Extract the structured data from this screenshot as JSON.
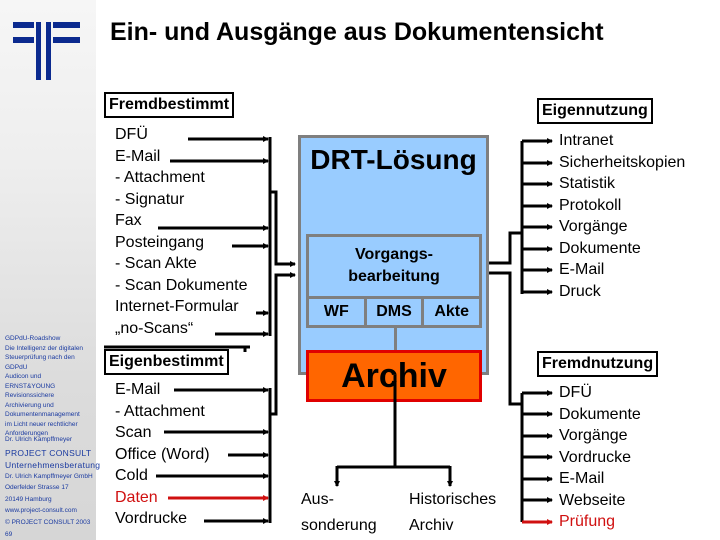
{
  "title": "Ein- und Ausgänge aus Dokumentensicht",
  "logo": {
    "icon": "company-logo-icon",
    "color": "#0b2a8f"
  },
  "sidebar": {
    "lines": [
      "GDPdU-Roadshow",
      "Die Intelligenz der digitalen",
      "Steuerprüfung nach den",
      "GDPdU",
      "Audicon und",
      "ERNST&YOUNG",
      "Revisionssichere",
      "Archivierung und",
      "Dokumentenmanagement",
      "im Licht neuer rechtlicher",
      "Anforderungen"
    ],
    "author": "Dr. Ulrich Kampffmeyer",
    "company_lines": [
      "PROJECT CONSULT",
      "Unternehmensberatung"
    ],
    "address_lines": [
      "Dr. Ulrich Kampffmeyer GmbH",
      "Oderfelder Strasse 17",
      "20149 Hamburg",
      "www.project-consult.com",
      "© PROJECT CONSULT 2003"
    ],
    "page_number": "69"
  },
  "fremdbestimmt": {
    "header": "Fremdbestimmt",
    "items": [
      "DFÜ",
      "E-Mail",
      "- Attachment",
      "- Signatur",
      "Fax",
      "Posteingang",
      "- Scan Akte",
      "- Scan Dokumente",
      "Internet-Formular",
      "„no-Scans“"
    ]
  },
  "eigenbestimmt": {
    "header": "Eigenbestimmt",
    "items": [
      "E-Mail",
      "- Attachment",
      "Scan",
      "Office (Word)",
      "Cold",
      "Daten",
      "Vordrucke"
    ],
    "highlight_item": "Daten"
  },
  "center": {
    "title": "DRT-Lösung",
    "vorgang": "Vorgangs-\nbearbeitung",
    "vorgang_line1": "Vorgangs-",
    "vorgang_line2": "bearbeitung",
    "cells": [
      "WF",
      "DMS",
      "Akte"
    ],
    "archiv": "Archiv",
    "outputs": {
      "left_line1": "Aus-",
      "left_line2": "sonderung",
      "right_line1": "Historisches",
      "right_line2": "Archiv"
    },
    "colors": {
      "box": "#99ccff",
      "border": "#7f7f7f",
      "archiv": "#ff6600",
      "archiv_border": "#e00000"
    }
  },
  "eigennutzung": {
    "header": "Eigennutzung",
    "items": [
      "Intranet",
      "Sicherheitskopien",
      "Statistik",
      "Protokoll",
      "Vorgänge",
      "Dokumente",
      "E-Mail",
      "Druck"
    ]
  },
  "fremdnutzung": {
    "header": "Fremdnutzung",
    "items": [
      "DFÜ",
      "Dokumente",
      "Vorgänge",
      "Vordrucke",
      "E-Mail",
      "Webseite",
      "Prüfung"
    ],
    "highlight_item": "Prüfung"
  },
  "highlight_color": "#d01010"
}
